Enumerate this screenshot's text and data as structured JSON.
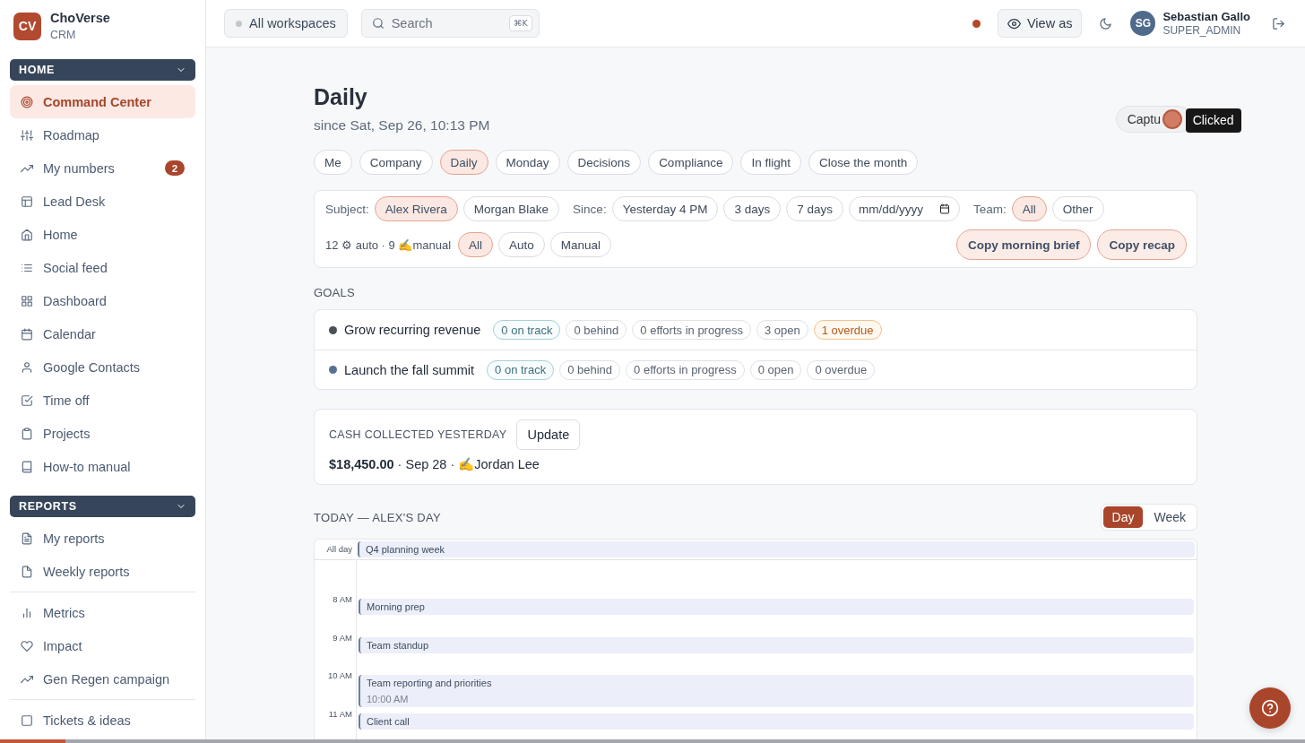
{
  "sidebar": {
    "brand": {
      "initials": "CV",
      "name": "ChoVerse",
      "subtitle": "CRM"
    },
    "sections": [
      {
        "title": "HOME",
        "expanded": true,
        "items": [
          {
            "label": "Command Center",
            "selected": true
          },
          {
            "label": "Roadmap",
            "selected": false
          },
          {
            "label": "My numbers",
            "selected": false,
            "badge": "2"
          },
          {
            "label": "Lead Desk",
            "selected": false
          },
          {
            "label": "Home",
            "selected": false
          },
          {
            "label": "Social feed",
            "selected": false
          },
          {
            "label": "Dashboard",
            "selected": false
          },
          {
            "label": "Calendar",
            "selected": false
          },
          {
            "label": "Google Contacts",
            "selected": false
          },
          {
            "label": "Time off",
            "selected": false
          },
          {
            "label": "Projects",
            "selected": false
          },
          {
            "label": "How-to manual",
            "selected": false
          }
        ]
      },
      {
        "title": "REPORTS",
        "expanded": true,
        "items": [
          {
            "label": "My reports",
            "selected": false
          },
          {
            "label": "Weekly reports",
            "selected": false
          }
        ]
      },
      {
        "items": [
          {
            "label": "Metrics",
            "selected": false
          },
          {
            "label": "Impact",
            "selected": false
          },
          {
            "label": "Gen Regen campaign",
            "selected": false
          }
        ]
      },
      {
        "items": [
          {
            "label": "Tickets & ideas",
            "selected": false
          }
        ]
      }
    ]
  },
  "topbar": {
    "workspace_button": "All workspaces",
    "search": {
      "placeholder": "Search",
      "shortcut": "⌘K"
    },
    "view_as_button": "View as",
    "user": {
      "initials": "SG",
      "name": "Sebastian Gallo",
      "role": "SUPER_ADMIN"
    }
  },
  "header": {
    "title": "Daily",
    "subtitle": "since Sat, Sep 26, 10:13 PM",
    "capture_button": "Captu",
    "click_tooltip": "Clicked"
  },
  "tabs": [
    {
      "label": "Me",
      "selected": false
    },
    {
      "label": "Company",
      "selected": false
    },
    {
      "label": "Daily",
      "selected": true
    },
    {
      "label": "Monday",
      "selected": false
    },
    {
      "label": "Decisions",
      "selected": false
    },
    {
      "label": "Compliance",
      "selected": false
    },
    {
      "label": "In flight",
      "selected": false
    },
    {
      "label": "Close the month",
      "selected": false
    }
  ],
  "filters": {
    "subject": {
      "label": "Subject:",
      "options": [
        {
          "label": "Alex Rivera",
          "selected": true
        },
        {
          "label": "Morgan Blake",
          "selected": false
        }
      ]
    },
    "since": {
      "label": "Since:",
      "options": [
        {
          "label": "Yesterday 4 PM",
          "selected": false
        },
        {
          "label": "3 days",
          "selected": false
        },
        {
          "label": "7 days",
          "selected": false
        }
      ],
      "date": {
        "placeholder": "mm/dd/yyyy"
      }
    },
    "team": {
      "label": "Team:",
      "options": [
        {
          "label": "All",
          "selected": true
        },
        {
          "label": "Other",
          "selected": false
        }
      ]
    },
    "source": {
      "summary": "12 ⚙ auto · 9 ✍manual",
      "options": [
        {
          "label": "All",
          "selected": true
        },
        {
          "label": "Auto",
          "selected": false
        },
        {
          "label": "Manual",
          "selected": false
        }
      ]
    },
    "actions": [
      "Copy morning brief",
      "Copy recap"
    ]
  },
  "goals": {
    "title": "GOALS",
    "items": [
      {
        "title": "Grow recurring revenue",
        "color": "#4a5058",
        "chips": [
          {
            "label": "0 on track",
            "kind": "positive"
          },
          {
            "label": "0 behind",
            "kind": "neutral"
          },
          {
            "label": "0 efforts in progress",
            "kind": "neutral"
          },
          {
            "label": "3 open",
            "kind": "neutral"
          },
          {
            "label": "1 overdue",
            "kind": "warning"
          }
        ]
      },
      {
        "title": "Launch the fall summit",
        "color": "#577190",
        "chips": [
          {
            "label": "0 on track",
            "kind": "positive"
          },
          {
            "label": "0 behind",
            "kind": "neutral"
          },
          {
            "label": "0 efforts in progress",
            "kind": "neutral"
          },
          {
            "label": "0 open",
            "kind": "neutral"
          },
          {
            "label": "0 overdue",
            "kind": "neutral"
          }
        ]
      }
    ]
  },
  "cash": {
    "title": "CASH COLLECTED YESTERDAY",
    "button": "Update",
    "summary": "**$18,450.00** · Sep 28 · ✍Jordan Lee"
  },
  "calendar": {
    "title": "TODAY — ALEX'S DAY",
    "views": [
      {
        "label": "Day",
        "selected": true
      },
      {
        "label": "Week",
        "selected": false
      }
    ],
    "all_day_label": "All day",
    "all_day_events": [
      {
        "title": "Q4 planning week"
      }
    ],
    "hours": [
      {
        "label": "8 AM",
        "events": [
          {
            "title": "Morning prep"
          }
        ]
      },
      {
        "label": "9 AM",
        "events": [
          {
            "title": "Team standup"
          }
        ]
      },
      {
        "label": "10 AM",
        "events": [
          {
            "title": "Team reporting and priorities",
            "time": "10:00 AM"
          }
        ]
      },
      {
        "label": "11 AM",
        "events": [
          {
            "title": "Client call"
          }
        ]
      }
    ]
  },
  "page_progress": {
    "level": 0.05
  }
}
